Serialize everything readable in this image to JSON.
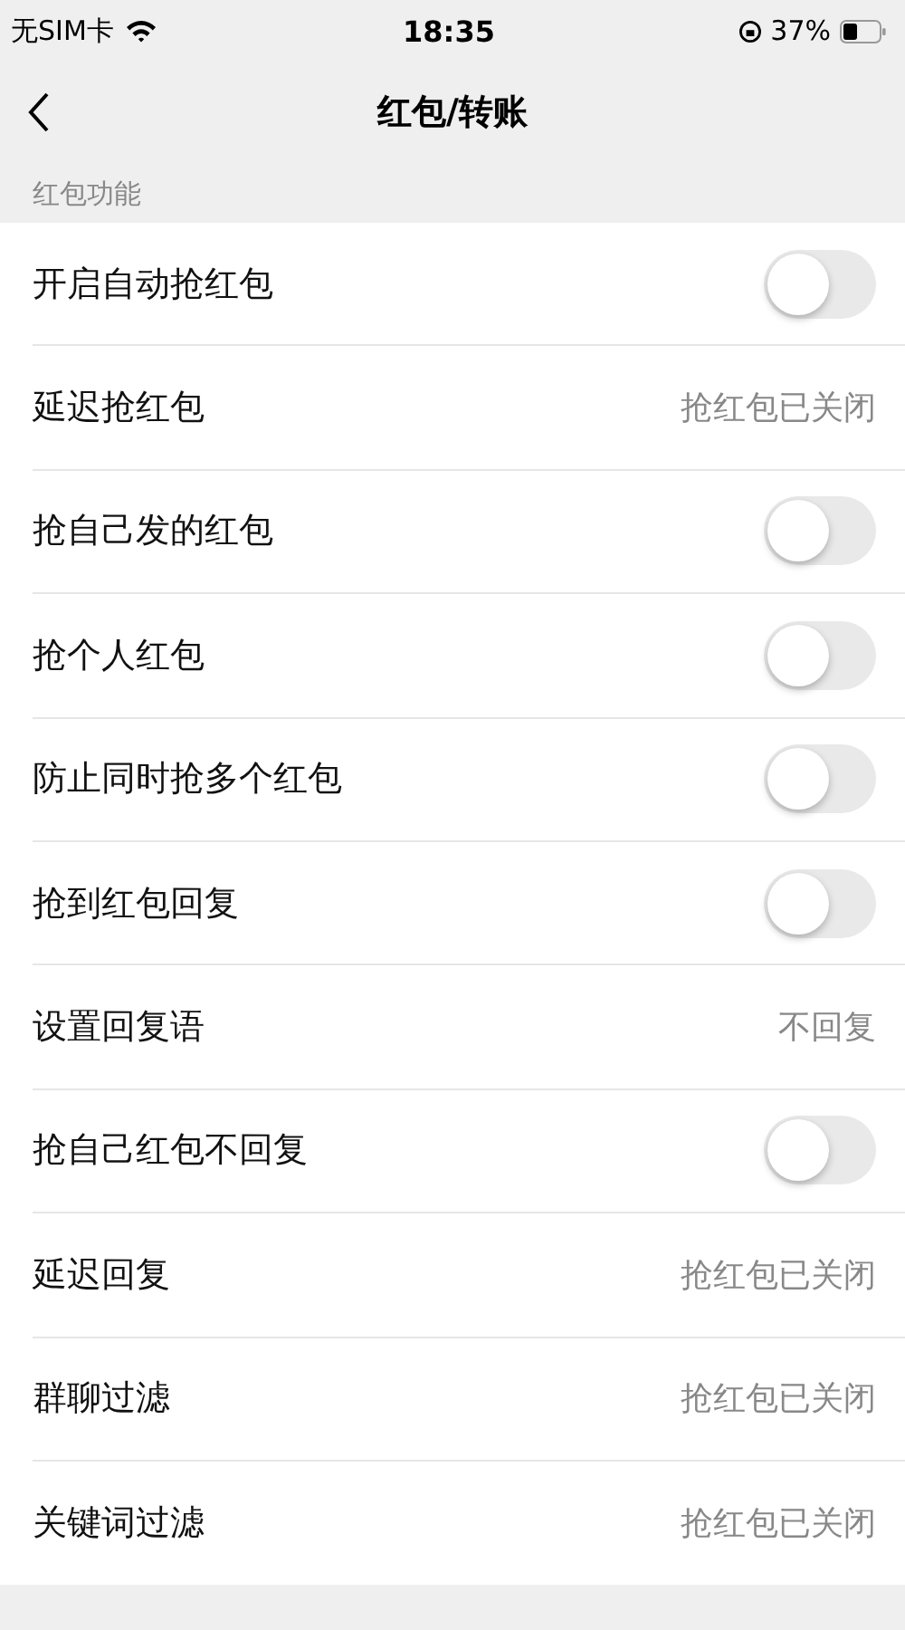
{
  "status_bar": {
    "carrier": "无SIM卡",
    "time": "18:35",
    "battery": "37%"
  },
  "nav": {
    "title": "红包/转账"
  },
  "section": {
    "title": "红包功能",
    "rows": [
      {
        "label": "开启自动抢红包",
        "kind": "toggle",
        "on": false
      },
      {
        "label": "延迟抢红包",
        "kind": "value",
        "value": "抢红包已关闭"
      },
      {
        "label": "抢自己发的红包",
        "kind": "toggle",
        "on": false
      },
      {
        "label": "抢个人红包",
        "kind": "toggle",
        "on": false
      },
      {
        "label": "防止同时抢多个红包",
        "kind": "toggle",
        "on": false
      },
      {
        "label": "抢到红包回复",
        "kind": "toggle",
        "on": false
      },
      {
        "label": "设置回复语",
        "kind": "value",
        "value": "不回复"
      },
      {
        "label": "抢自己红包不回复",
        "kind": "toggle",
        "on": false
      },
      {
        "label": "延迟回复",
        "kind": "value",
        "value": "抢红包已关闭"
      },
      {
        "label": "群聊过滤",
        "kind": "value",
        "value": "抢红包已关闭"
      },
      {
        "label": "关键词过滤",
        "kind": "value",
        "value": "抢红包已关闭"
      }
    ]
  }
}
